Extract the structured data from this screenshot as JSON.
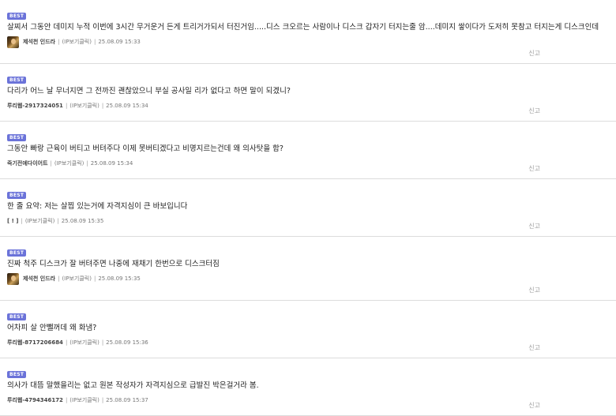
{
  "best_label": "BEST",
  "report_label": "신고",
  "comments": [
    {
      "text": "살찌서 그동안 데미지 누적 이번에 3시간 무거운거 든게 트리거가되서 터진거임.....디스 크오르는 사람이나 디스크 갑자기 터지는줄 암....데미지 쌓이다가 도저히 못참고 터지는게 디스크인데",
      "nick": "제석천 인드라",
      "ip": "(IP보기클릭)",
      "date": "25.08.09 15:33"
    },
    {
      "text": "다리가 어느 날 무너지면 그 전까진 괜찮았으니 부실 공사일 리가 없다고 하면 말이 되겠니?",
      "nick": "루리웹-2917324051",
      "ip": "(IP보기클릭)",
      "date": "25.08.09 15:34"
    },
    {
      "text": "그동안 빠랑 근육이 버티고 버텨주다 이제 못버티겠다고 비명지르는건데 왜 의사탓을 함?",
      "nick": "죽기전에다이어트",
      "ip": "(IP보기클릭)",
      "date": "25.08.09 15:34"
    },
    {
      "text": "한 줄 요약: 저는 살찝 있는거에 자격지심이 큰 바보입니다",
      "nick": "[ ! ]",
      "ip": "(IP보기클릭)",
      "date": "25.08.09 15:35"
    },
    {
      "text": "진짜 척주 디스크가 잘 버텨주면 나중에 재채기 한번으로 디스크터짐",
      "nick": "제석천 인드라",
      "ip": "(IP보기클릭)",
      "date": "25.08.09 15:35"
    },
    {
      "text": "어차피 살 안뺄꺼데 왜 화냄?",
      "nick": "루리웹-8717206684",
      "ip": "(IP보기클릭)",
      "date": "25.08.09 15:36"
    },
    {
      "text": "의사가 대뜸 말했을리는 없고 원본 작성자가 자격지심으로 급발진 박은걸거라 봄.",
      "nick": "루리웹-4794346172",
      "ip": "(IP보기클릭)",
      "date": "25.08.09 15:37"
    }
  ]
}
